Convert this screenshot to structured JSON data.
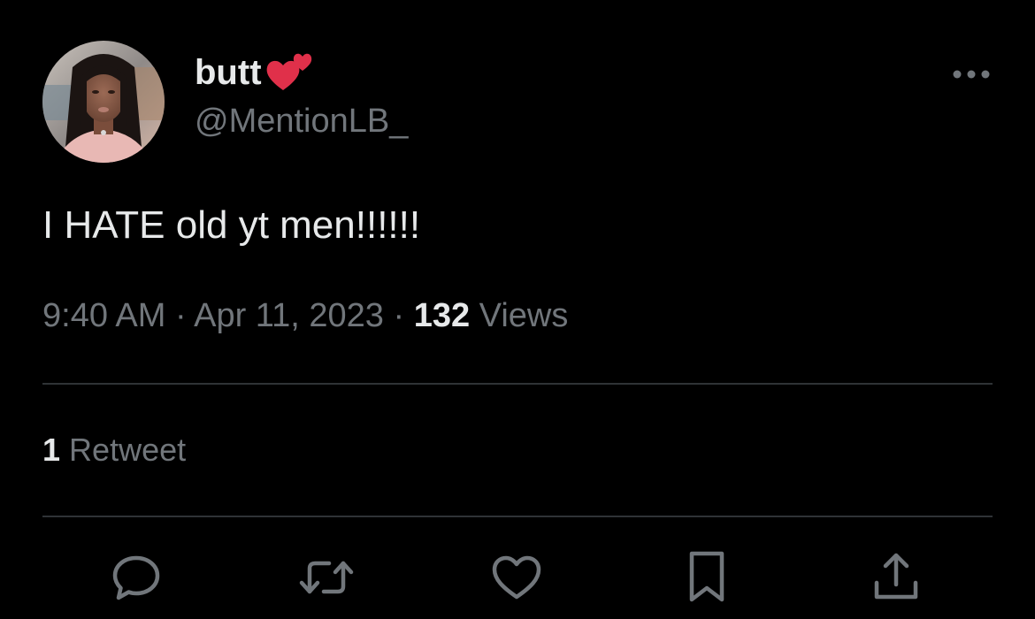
{
  "author": {
    "display_name": "butt",
    "handle": "@MentionLB_",
    "avatar_icon": "profile-photo",
    "name_emoji_icon": "two-hearts-icon"
  },
  "tweet": {
    "text": "I HATE old yt men!!!!!!"
  },
  "meta": {
    "time": "9:40 AM",
    "separator": "·",
    "date": "Apr 11, 2023",
    "views_count": "132",
    "views_label": "Views"
  },
  "stats": {
    "retweet_count": "1",
    "retweet_label": "Retweet"
  },
  "actions": {
    "reply_icon": "reply-icon",
    "retweet_icon": "retweet-icon",
    "like_icon": "heart-icon",
    "bookmark_icon": "bookmark-icon",
    "share_icon": "share-icon"
  },
  "colors": {
    "background": "#000000",
    "primary_text": "#e7e9ea",
    "secondary_text": "#71767b",
    "divider": "#2f3336",
    "heart_emoji": "#e0304a"
  }
}
